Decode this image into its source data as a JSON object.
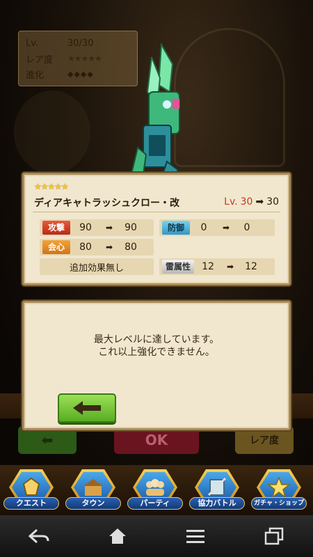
{
  "status": {
    "level_label": "Lv.",
    "level_value": "30/30",
    "rarity_label": "レア度",
    "rarity_stars": "★★★★★",
    "evolution_label": "進化",
    "evolution_dots": "◆◆◆◆"
  },
  "background_buttons": {
    "ok_label": "OK",
    "rarity_label": "レア度"
  },
  "item": {
    "stars": "★★★★★",
    "name": "ディアキャトラッシュクロー・改",
    "level_label": "Lv.",
    "level_current": "30",
    "level_next": "30",
    "attack": {
      "label": "攻撃",
      "from": "90",
      "to": "90"
    },
    "defense": {
      "label": "防御",
      "from": "0",
      "to": "0"
    },
    "critical": {
      "label": "会心",
      "from": "80",
      "to": "80"
    },
    "extra_effect": "追加効果無し",
    "thunder": {
      "label": "雷属性",
      "from": "12",
      "to": "12"
    }
  },
  "message": {
    "line1": "最大レベルに達しています。",
    "line2": "これ以上強化できません。"
  },
  "menu": [
    {
      "label": "クエスト",
      "icon": "quest-icon"
    },
    {
      "label": "タウン",
      "icon": "town-icon"
    },
    {
      "label": "パーティ",
      "icon": "party-icon"
    },
    {
      "label": "協力バトル",
      "icon": "coop-battle-icon"
    },
    {
      "label": "ガチャ・ショップ",
      "icon": "gacha-shop-icon"
    }
  ],
  "colors": {
    "card_bg": "#f1e7cf",
    "back_button": "#6fc02e",
    "level_red": "#c23a20",
    "menu_blue": "#2a5fb0"
  }
}
